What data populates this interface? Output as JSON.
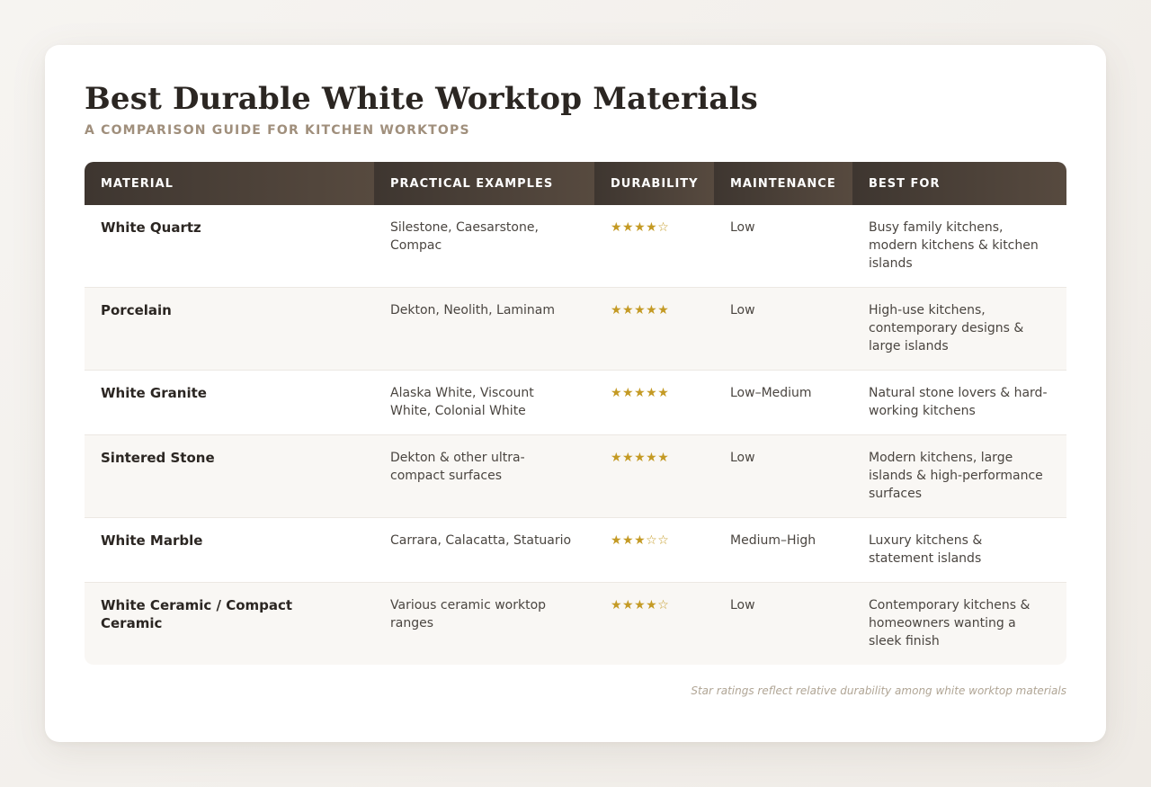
{
  "header": {
    "title": "Best Durable White Worktop Materials",
    "subtitle": "A COMPARISON GUIDE FOR KITCHEN WORKTOPS"
  },
  "table": {
    "columns": [
      "MATERIAL",
      "PRACTICAL EXAMPLES",
      "DURABILITY",
      "MAINTENANCE",
      "BEST FOR"
    ],
    "rows": [
      {
        "material": "White Quartz",
        "examples": "Silestone, Caesarstone, Compac",
        "durability": "★★★★☆",
        "durability_rating": 4,
        "maintenance": "Low",
        "best_for": "Busy family kitchens, modern kitchens & kitchen islands"
      },
      {
        "material": "Porcelain",
        "examples": "Dekton, Neolith, Laminam",
        "durability": "★★★★★",
        "durability_rating": 5,
        "maintenance": "Low",
        "best_for": "High-use kitchens, contemporary designs & large islands"
      },
      {
        "material": "White Granite",
        "examples": "Alaska White, Viscount White, Colonial White",
        "durability": "★★★★★",
        "durability_rating": 5,
        "maintenance": "Low–Medium",
        "best_for": "Natural stone lovers & hard-working kitchens"
      },
      {
        "material": "Sintered Stone",
        "examples": "Dekton & other ultra-compact surfaces",
        "durability": "★★★★★",
        "durability_rating": 5,
        "maintenance": "Low",
        "best_for": "Modern kitchens, large islands & high-performance surfaces"
      },
      {
        "material": "White Marble",
        "examples": "Carrara, Calacatta, Statuario",
        "durability": "★★★☆☆",
        "durability_rating": 3,
        "maintenance": "Medium–High",
        "best_for": "Luxury kitchens & statement islands"
      },
      {
        "material": "White Ceramic / Compact Ceramic",
        "examples": "Various ceramic worktop ranges",
        "durability": "★★★★☆",
        "durability_rating": 4,
        "maintenance": "Low",
        "best_for": "Contemporary kitchens & homeowners wanting a sleek finish"
      }
    ]
  },
  "footnote": "Star ratings reflect relative durability among white worktop materials",
  "colors": {
    "header_dark": "#3e3630",
    "header_light": "#574a3f",
    "star_gold": "#c49a24",
    "subtitle": "#a08f7c"
  }
}
